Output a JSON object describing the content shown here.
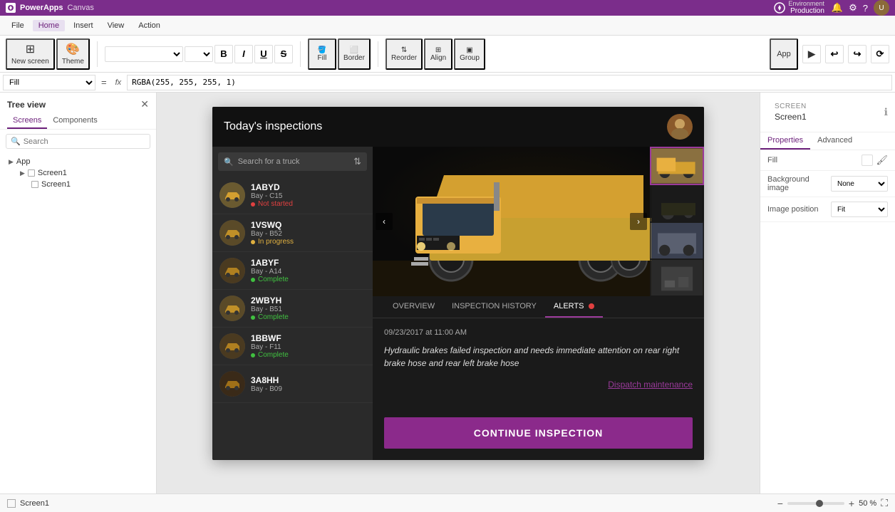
{
  "topbar": {
    "brand": "PowerApps",
    "canvas_label": "Canvas",
    "env_name": "Production",
    "env_label": "Environment",
    "icons": [
      "bell",
      "settings",
      "help",
      "user-circle"
    ]
  },
  "menubar": {
    "items": [
      "File",
      "Home",
      "Insert",
      "View",
      "Action"
    ]
  },
  "ribbon": {
    "new_screen": "New screen",
    "theme": "Theme",
    "app_btn": "App",
    "fill_label": "Fill",
    "border_label": "Border",
    "reorder_label": "Reorder",
    "align_label": "Align",
    "group_label": "Group"
  },
  "formulabar": {
    "dropdown_value": "Fill",
    "formula_value": "RGBA(255, 255, 255, 1)"
  },
  "treepanel": {
    "title": "Tree view",
    "tabs": [
      "Screens",
      "Components"
    ],
    "active_tab": "Screens",
    "search_placeholder": "Search",
    "app_item": "App",
    "screens": [
      "Screen1",
      "Screen1"
    ]
  },
  "app": {
    "header": {
      "title": "Today's inspections"
    },
    "search_placeholder": "Search for a truck",
    "trucks": [
      {
        "id": "1ABYD",
        "bay": "Bay - C15",
        "status": "Not started",
        "status_color": "red"
      },
      {
        "id": "1VSWQ",
        "bay": "Bay - B52",
        "status": "In progress",
        "status_color": "yellow"
      },
      {
        "id": "1ABYF",
        "bay": "Bay - A14",
        "status": "Complete",
        "status_color": "green"
      },
      {
        "id": "2WBYH",
        "bay": "Bay - B51",
        "status": "Complete",
        "status_color": "green"
      },
      {
        "id": "1BBWF",
        "bay": "Bay - F11",
        "status": "Complete",
        "status_color": "green"
      },
      {
        "id": "3A8HH",
        "bay": "Bay - B09",
        "status": "",
        "status_color": ""
      }
    ],
    "tabs": [
      {
        "label": "OVERVIEW",
        "active": false
      },
      {
        "label": "INSPECTION HISTORY",
        "active": false
      },
      {
        "label": "ALERTS",
        "active": true,
        "badge": true
      }
    ],
    "alert": {
      "timestamp": "09/23/2017 at 11:00 AM",
      "message": "Hydraulic brakes failed inspection and needs immediate attention on rear right brake hose and rear left brake hose",
      "dispatch_link": "Dispatch maintenance"
    },
    "continue_btn": "CONTINUE INSPECTION"
  },
  "rightpanel": {
    "screen_label": "SCREEN",
    "screen_name": "Screen1",
    "tabs": [
      "Properties",
      "Advanced"
    ],
    "active_tab": "Properties",
    "properties": [
      {
        "label": "Fill",
        "value": "",
        "type": "paint"
      },
      {
        "label": "Background image",
        "value": "None",
        "type": "select"
      },
      {
        "label": "Image position",
        "value": "Fit",
        "type": "select"
      }
    ]
  },
  "bottombar": {
    "screen_label": "Screen1",
    "zoom_percent": "50 %"
  }
}
